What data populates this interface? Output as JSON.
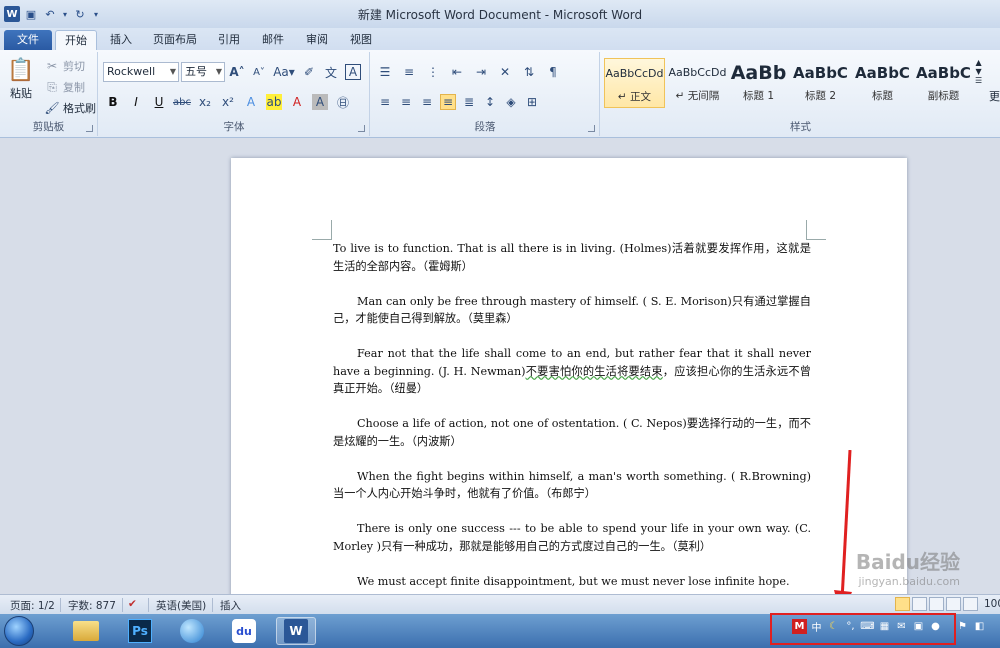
{
  "window": {
    "title": "新建 Microsoft Word Document - Microsoft Word"
  },
  "qat": {
    "word_icon": "W",
    "save_icon": "save-icon",
    "undo_icon": "undo-icon",
    "redo_icon": "redo-icon"
  },
  "tabs": [
    "文件",
    "开始",
    "插入",
    "页面布局",
    "引用",
    "邮件",
    "审阅",
    "视图"
  ],
  "ribbon": {
    "clipboard": {
      "paste": "粘贴",
      "cut": "剪切",
      "copy": "复制",
      "format_painter": "格式刷",
      "label": "剪贴板"
    },
    "font": {
      "font_name": "Rockwell",
      "font_size": "五号",
      "label": "字体"
    },
    "paragraph": {
      "label": "段落"
    },
    "styles": {
      "label": "样式",
      "items": [
        {
          "preview": "AaBbCcDd",
          "name": "↵ 正文"
        },
        {
          "preview": "AaBbCcDd",
          "name": "↵ 无间隔"
        },
        {
          "preview": "AaBb",
          "name": "标题 1"
        },
        {
          "preview": "AaBbC",
          "name": "标题 2"
        },
        {
          "preview": "AaBbC",
          "name": "标题"
        },
        {
          "preview": "AaBbC",
          "name": "副标题"
        }
      ],
      "more": "更"
    }
  },
  "document": {
    "p1": "To live is to function. That is all there is in living. (Holmes)活着就要发挥作用，这就是生活的全部内容。（霍姆斯）",
    "p2": "Man can only be free through mastery of himself. ( S. E. Morison)只有通过掌握自己，才能使自己得到解放。（莫里森）",
    "p3a": "Fear not that the life shall come to an end, but rather fear that it shall never have a beginning. (J. H. Newman)",
    "p3b": "不要害怕你的生活将要结束",
    "p3c": "，应该担心你的生活永远不曾真正开始。（纽曼）",
    "p4": "Choose a life of action, not one of ostentation. ( C. Nepos)要选择行动的一生，而不是炫耀的一生。（内波斯）",
    "p5": "When the fight begins within himself, a man's worth something. ( R.Browning)当一个人内心开始斗争时，他就有了价值。（布郎宁）",
    "p6": "There is only one success --- to be able to spend your life in your own way. (C. Morley )只有一种成功，那就是能够用自己的方式度过自己的一生。（莫利）",
    "p7": "We must accept finite disappointment, but we must never lose infinite hope."
  },
  "watermark": {
    "brand": "Baidu经验",
    "url": "jingyan.baidu.com"
  },
  "status": {
    "page": "页面: 1/2",
    "words": "字数: 877",
    "language": "英语(美国)",
    "mode": "插入",
    "zoom": "100"
  },
  "taskbar": {
    "ps_label": "Ps",
    "baidu_label": "du",
    "word_label": "W"
  },
  "colors": {
    "accent": "#2b5797",
    "highlight": "#e02020"
  }
}
